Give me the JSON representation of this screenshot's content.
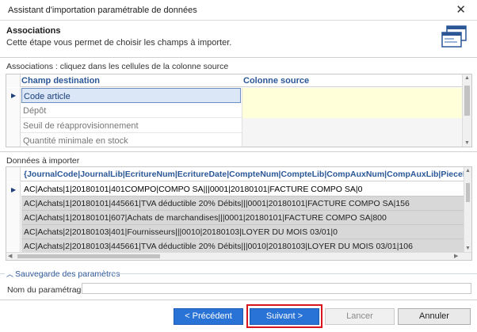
{
  "window": {
    "title": "Assistant d'importation paramétrable de données",
    "close_icon": "close-icon"
  },
  "header": {
    "step_title": "Associations",
    "step_description": "Cette étape vous permet de choisir les champs à importer.",
    "icon": "wizard-windows-icon"
  },
  "associations": {
    "label": "Associations : cliquez dans les cellules de la colonne source",
    "columns": [
      "Champ destination",
      "Colonne source"
    ],
    "rows": [
      {
        "dest": "Code article",
        "source": ""
      },
      {
        "dest": "Dépôt",
        "source": ""
      },
      {
        "dest": "Seuil de réapprovisionnement",
        "source": ""
      },
      {
        "dest": "Quantité minimale en stock",
        "source": ""
      }
    ]
  },
  "import_data": {
    "label": "Données à importer",
    "header": "{JournalCode|JournalLib|EcritureNum|EcritureDate|CompteNum|CompteLib|CompAuxNum|CompAuxLib|PieceRef|Pieces",
    "rows": [
      "AC|Achats|1|20180101|401COMPO|COMPO SA|||0001|20180101|FACTURE COMPO SA|0",
      "AC|Achats|1|20180101|445661|TVA déductible 20% Débits|||0001|20180101|FACTURE COMPO SA|156",
      "AC|Achats|1|20180101|607|Achats de marchandises|||0001|20180101|FACTURE COMPO SA|800",
      "AC|Achats|2|20180103|401|Fournisseurs|||0010|20180103|LOYER DU MOIS 03/01|0",
      "AC|Achats|2|20180103|445661|TVA déductible 20% Débits|||0010|20180103|LOYER DU MOIS 03/01|106"
    ]
  },
  "save_params": {
    "group_title": "Sauvegarde des paramètres",
    "name_label": "Nom du paramétrage",
    "name_value": "",
    "name_placeholder": ""
  },
  "buttons": {
    "previous": "< Précédent",
    "next": "Suivant >",
    "cancel_import": "Lancer",
    "cancel": "Annuler"
  },
  "colors": {
    "accent": "#2a73d6",
    "highlight": "#d8141d",
    "source_cell": "#ffffd9"
  }
}
